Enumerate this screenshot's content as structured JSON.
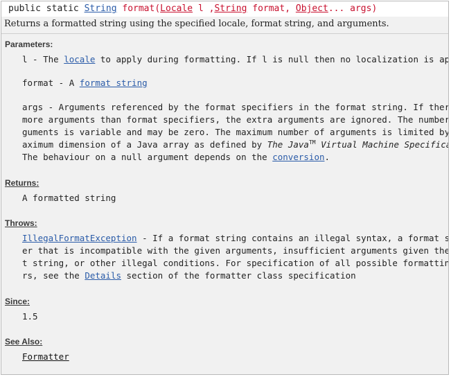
{
  "signature": {
    "prefix": "public static ",
    "return_type": "String",
    "method_name": " format(",
    "param1_type": "Locale",
    "param1_name": " l ,",
    "param2_type": "String",
    "param2_name": " format, ",
    "param3_type": "Object",
    "param3_rest": "... args)"
  },
  "summary": "Returns a formatted string using the specified locale, format string, and arguments.",
  "parameters": {
    "header": "Parameters:",
    "l": {
      "prefix": "l - The ",
      "link": "locale",
      "suffix": " to apply during formatting. If l is null then no localization is applied."
    },
    "format": {
      "prefix": "format - A ",
      "link": "format string"
    },
    "args": {
      "line1": "args - Arguments referenced by the format specifiers in the format string. If there are",
      "line2": "more arguments than format specifiers, the extra arguments are ignored. The number of ar",
      "line3": "guments is variable and may be zero. The maximum number of arguments is limited by the m",
      "line4_prefix": "aximum dimension of a Java array as defined by ",
      "line4_italic1": "The Java",
      "line4_tm": "TM",
      "line4_italic2": " Virtual Machine Specification",
      "line4_suffix": ".",
      "line5_prefix": "The behaviour on a null argument depends on the ",
      "line5_link": "conversion",
      "line5_suffix": "."
    }
  },
  "returns": {
    "header": "Returns:",
    "text": "A formatted string"
  },
  "throws": {
    "header": "Throws:",
    "link": "IllegalFormatException",
    "line1_suffix": " - If a format string contains an illegal syntax, a format specifi",
    "line2": "er that is incompatible with the given arguments, insufficient arguments given the forma",
    "line3": "t string, or other illegal conditions. For specification of all possible formatting erro",
    "line4_prefix": "rs, see the ",
    "line4_link": "Details",
    "line4_suffix": " section of the formatter class specification"
  },
  "since": {
    "header": "Since:",
    "text": "1.5"
  },
  "see_also": {
    "header": "See Also:",
    "link": "Formatter"
  },
  "colors": {
    "link": "#2a5ba8",
    "method_red": "#c8102e",
    "panel_bg": "#f1f1f1"
  }
}
